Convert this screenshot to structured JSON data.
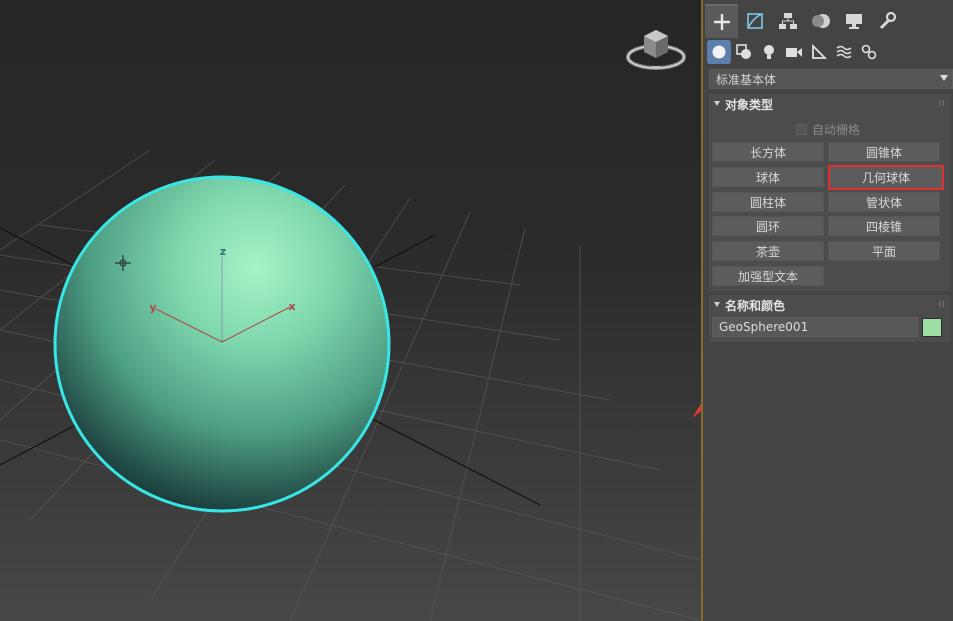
{
  "panel": {
    "tabs": [
      {
        "icon": "plus-icon",
        "active": true
      },
      {
        "icon": "modify-icon",
        "active": false
      },
      {
        "icon": "hierarchy-icon",
        "active": false
      },
      {
        "icon": "motion-icon",
        "active": false
      },
      {
        "icon": "display-icon",
        "active": false
      },
      {
        "icon": "utilities-wrench-icon",
        "active": false
      }
    ],
    "subtabs": [
      {
        "icon": "geometry-sphere-icon",
        "active": true
      },
      {
        "icon": "shapes-icon",
        "active": false
      },
      {
        "icon": "lights-bulb-icon",
        "active": false
      },
      {
        "icon": "cameras-icon",
        "active": false
      },
      {
        "icon": "helpers-ruler-icon",
        "active": false
      },
      {
        "icon": "spacewarps-icon",
        "active": false
      },
      {
        "icon": "systems-gears-icon",
        "active": false
      }
    ],
    "category_dropdown": "标准基本体",
    "object_type": {
      "title": "对象类型",
      "autogrid_label": "自动栅格",
      "autogrid_checked": false,
      "buttons": [
        "长方体",
        "圆锥体",
        "球体",
        "几何球体",
        "圆柱体",
        "管状体",
        "圆环",
        "四棱锥",
        "茶壶",
        "平面",
        "加强型文本"
      ],
      "selected_button": "几何球体"
    },
    "name_color": {
      "title": "名称和颜色",
      "object_name": "GeoSphere001",
      "color": "#9ee0a4"
    }
  },
  "viewport": {
    "axis_labels": {
      "z": "z",
      "x": "x",
      "y": "y"
    },
    "object_color": "#7dd6ad",
    "selection_outline_color": "#39e6e6",
    "annotation_color": "#e83a2a"
  }
}
